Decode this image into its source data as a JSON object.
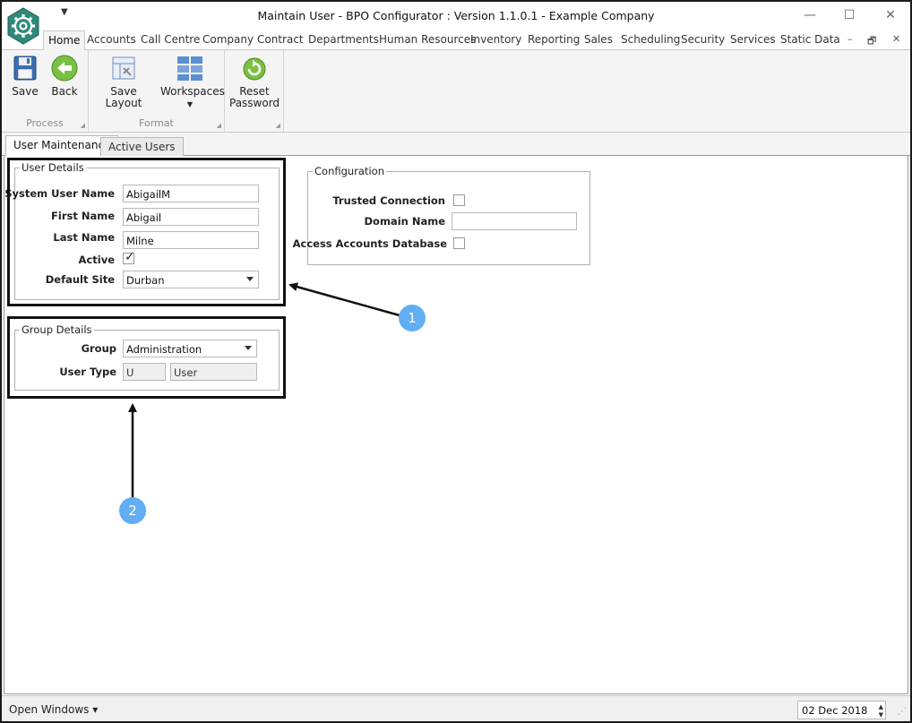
{
  "window": {
    "title": "Maintain User - BPO Configurator : Version 1.1.0.1 - Example Company",
    "qat_icon": "dropdown-arrow-icon",
    "controls": [
      "minimize-icon",
      "maximize-icon",
      "close-icon"
    ],
    "minimize_glyph": "—",
    "maximize_glyph": "☐",
    "close_glyph": "✕"
  },
  "ribbon_tabs": [
    "Home",
    "Accounts",
    "Call Centre",
    "Company",
    "Contract",
    "Departments",
    "Human Resources",
    "Inventory",
    "Reporting",
    "Sales",
    "Scheduling",
    "Security",
    "Services",
    "Static Data"
  ],
  "mdi_controls": {
    "minimize": "–",
    "restore": "🗗",
    "close": "✕"
  },
  "ribbon": {
    "process": {
      "label": "Process",
      "save": "Save",
      "back": "Back"
    },
    "format": {
      "label": "Format",
      "save_layout": "Save Layout",
      "workspaces": "Workspaces"
    },
    "password": {
      "reset_line1": "Reset",
      "reset_line2": "Password"
    }
  },
  "doc_tabs": [
    "User Maintenance",
    "Active Users"
  ],
  "user_details": {
    "legend": "User Details",
    "system_user_name_label": "System User Name",
    "system_user_name": "AbigailM",
    "first_name_label": "First Name",
    "first_name": "Abigail",
    "last_name_label": "Last Name",
    "last_name": "Milne",
    "active_label": "Active",
    "active_checked": true,
    "active_mark": "✓",
    "default_site_label": "Default Site",
    "default_site": "Durban"
  },
  "group_details": {
    "legend": "Group Details",
    "group_label": "Group",
    "group": "Administration",
    "user_type_label": "User Type",
    "user_type_code": "U",
    "user_type_name": "User"
  },
  "configuration": {
    "legend": "Configuration",
    "trusted_connection_label": "Trusted Connection",
    "trusted_connection": false,
    "domain_name_label": "Domain Name",
    "domain_name": "",
    "access_accounts_db_label": "Access Accounts Database",
    "access_accounts_db": false
  },
  "callouts": [
    "1",
    "2"
  ],
  "status_bar": {
    "open_windows": "Open Windows ▾",
    "date": "02 Dec 2018",
    "spin_up": "▲",
    "spin_down": "▼",
    "grip": "⋰"
  },
  "colors": {
    "accent": "#63aef3",
    "logo": "#2f8a78",
    "ribbon_bg": "#f4f4f4",
    "highlight_border": "#111111"
  }
}
